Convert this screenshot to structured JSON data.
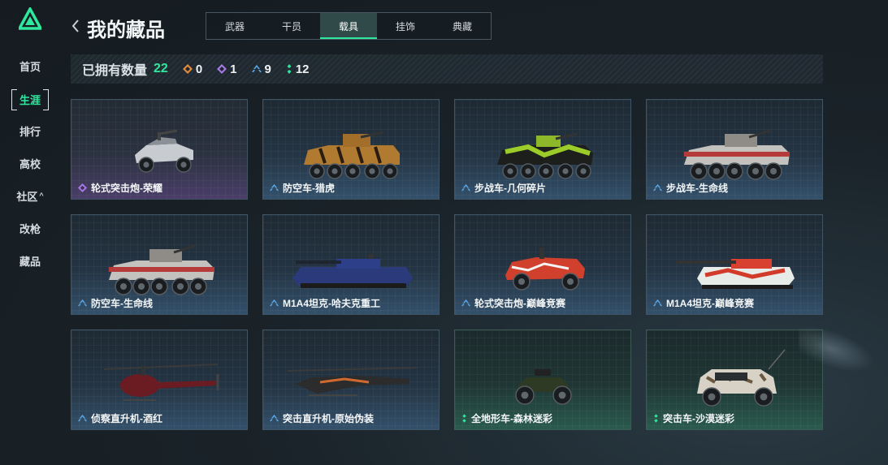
{
  "sidebar": {
    "items": [
      {
        "label": "首页",
        "active": false
      },
      {
        "label": "生涯",
        "active": true
      },
      {
        "label": "排行",
        "active": false
      },
      {
        "label": "高校",
        "active": false
      },
      {
        "label": "社区",
        "active": false,
        "caret": "^"
      },
      {
        "label": "改枪",
        "active": false
      },
      {
        "label": "藏品",
        "active": false
      }
    ]
  },
  "header": {
    "title": "我的藏品"
  },
  "tabs": [
    {
      "label": "武器",
      "active": false
    },
    {
      "label": "干员",
      "active": false
    },
    {
      "label": "载具",
      "active": true
    },
    {
      "label": "挂饰",
      "active": false
    },
    {
      "label": "典藏",
      "active": false
    }
  ],
  "stats": {
    "owned_label": "已拥有数量",
    "owned_count": "22",
    "rarity_counts": [
      {
        "icon": "orange-diamond-icon",
        "color": "#e08a3c",
        "value": "0"
      },
      {
        "icon": "purple-diamond-icon",
        "color": "#a678e8",
        "value": "1"
      },
      {
        "icon": "blue-chevron-icon",
        "color": "#5aa8e8",
        "value": "9"
      },
      {
        "icon": "green-dots-icon",
        "color": "#2fe8a0",
        "value": "12"
      }
    ]
  },
  "colors": {
    "accent": "#2fe8a0",
    "purple": "#a678e8",
    "blue": "#5aa8e8",
    "green": "#2fe8a0"
  },
  "vehicles": [
    {
      "name": "轮式突击炮-荣耀",
      "rarity": "purple",
      "type": "light-buggy"
    },
    {
      "name": "防空车-猎虎",
      "rarity": "blue",
      "type": "apc-tiger"
    },
    {
      "name": "步战车-几何碎片",
      "rarity": "blue",
      "type": "apc-green"
    },
    {
      "name": "步战车-生命线",
      "rarity": "blue",
      "type": "apc-lifeline"
    },
    {
      "name": "防空车-生命线",
      "rarity": "blue",
      "type": "apc-lifeline"
    },
    {
      "name": "M1A4坦克-哈夫克重工",
      "rarity": "blue",
      "type": "tank-blue"
    },
    {
      "name": "轮式突击炮-巅峰竞赛",
      "rarity": "blue",
      "type": "buggy-red"
    },
    {
      "name": "M1A4坦克-巅峰竞赛",
      "rarity": "blue",
      "type": "tank-red"
    },
    {
      "name": "侦察直升机-酒红",
      "rarity": "blue",
      "type": "heli-small"
    },
    {
      "name": "突击直升机-原始伪装",
      "rarity": "blue",
      "type": "heli-attack"
    },
    {
      "name": "全地形车-森林迷彩",
      "rarity": "green",
      "type": "atv"
    },
    {
      "name": "突击车-沙漠迷彩",
      "rarity": "green",
      "type": "assault-car"
    }
  ]
}
